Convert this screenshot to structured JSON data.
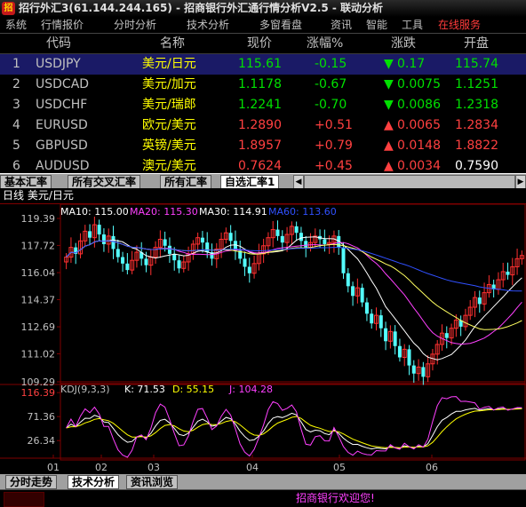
{
  "window": {
    "title": "招行外汇3(61.144.244.165) - 招商银行外汇通行情分析V2.5 - 联动分析",
    "logo_char": "招"
  },
  "menu": {
    "items": [
      {
        "label": "系统",
        "hot": false
      },
      {
        "label": "行情报价",
        "hot": false
      },
      {
        "label": "分时分析",
        "hot": false
      },
      {
        "label": "技术分析",
        "hot": false
      },
      {
        "label": "多窗看盘",
        "hot": false
      },
      {
        "label": "资讯",
        "hot": false
      },
      {
        "label": "智能",
        "hot": false
      },
      {
        "label": "工具",
        "hot": false
      },
      {
        "label": "在线服务",
        "hot": true
      }
    ]
  },
  "quotes": {
    "headers": {
      "code": "代码",
      "name": "名称",
      "price": "现价",
      "pct": "涨幅%",
      "change": "涨跌",
      "open": "开盘"
    },
    "rows": [
      {
        "num": "1",
        "code": "USDJPY",
        "name": "美元/日元",
        "price": "115.61",
        "pct": "-0.15",
        "change": "0.17",
        "dir": "down",
        "open": "115.74",
        "open_dir": "down"
      },
      {
        "num": "2",
        "code": "USDCAD",
        "name": "美元/加元",
        "price": "1.1178",
        "pct": "-0.67",
        "change": "0.0075",
        "dir": "down",
        "open": "1.1251",
        "open_dir": "down"
      },
      {
        "num": "3",
        "code": "USDCHF",
        "name": "美元/瑞郎",
        "price": "1.2241",
        "pct": "-0.70",
        "change": "0.0086",
        "dir": "down",
        "open": "1.2318",
        "open_dir": "down"
      },
      {
        "num": "4",
        "code": "EURUSD",
        "name": "欧元/美元",
        "price": "1.2890",
        "pct": "+0.51",
        "change": "0.0065",
        "dir": "up",
        "open": "1.2834",
        "open_dir": "up"
      },
      {
        "num": "5",
        "code": "GBPUSD",
        "name": "英镑/美元",
        "price": "1.8957",
        "pct": "+0.79",
        "change": "0.0148",
        "dir": "up",
        "open": "1.8822",
        "open_dir": "up"
      },
      {
        "num": "6",
        "code": "AUDUSD",
        "name": "澳元/美元",
        "price": "0.7624",
        "pct": "+0.45",
        "change": "0.0034",
        "dir": "up",
        "open": "0.7590",
        "open_dir": "flat"
      }
    ]
  },
  "rate_tabs": [
    "基本汇率",
    "所有交叉汇率",
    "所有汇率",
    "自选汇率1"
  ],
  "chart": {
    "header": "日线 美元/日元",
    "ma_labels": [
      {
        "text": "MA10: 115.00",
        "color": "#ffffff"
      },
      {
        "text": "MA20: 115.30",
        "color": "#ff40ff"
      },
      {
        "text": "MA30: 114.91",
        "color": "#ffffff"
      },
      {
        "text": "MA60: 113.60",
        "color": "#3050ff"
      }
    ],
    "kdj_labels": [
      {
        "text": "KDJ(9,3,3)",
        "color": "#c0c0c0"
      },
      {
        "text": "K: 71.53",
        "color": "#ffffff"
      },
      {
        "text": "D: 55.15",
        "color": "#ffff00"
      },
      {
        "text": "J: 104.28",
        "color": "#ff40ff"
      }
    ],
    "price_ticks": [
      "119.39",
      "117.72",
      "116.04",
      "114.37",
      "112.69",
      "111.02",
      "109.29"
    ],
    "kdj_ticks": [
      "116.39",
      "71.36",
      "26.34"
    ],
    "month_ticks": [
      "01",
      "02",
      "03",
      "04",
      "05",
      "06"
    ]
  },
  "chart_data": {
    "type": "candlestick",
    "title": "日线 美元/日元",
    "ylim": [
      109.29,
      119.39
    ],
    "x": [
      "01",
      "02",
      "03",
      "04",
      "05",
      "06"
    ],
    "closes": [
      117.0,
      117.6,
      117.2,
      118.0,
      118.6,
      118.2,
      119.0,
      118.4,
      117.8,
      118.3,
      117.5,
      117.0,
      116.6,
      116.2,
      116.8,
      117.3,
      116.9,
      116.5,
      117.0,
      117.6,
      118.1,
      117.7,
      117.2,
      116.8,
      116.3,
      116.7,
      117.2,
      117.8,
      118.2,
      117.9,
      117.3,
      116.9,
      117.5,
      118.1,
      118.5,
      118.0,
      117.4,
      116.9,
      116.4,
      116.0,
      116.6,
      117.2,
      117.7,
      118.2,
      118.7,
      118.3,
      117.9,
      118.4,
      118.9,
      118.5,
      118.0,
      117.6,
      117.9,
      118.3,
      118.1,
      117.8,
      117.9,
      118.3,
      117.6,
      116.0,
      115.2,
      114.6,
      115.1,
      114.2,
      113.5,
      112.9,
      113.4,
      112.6,
      111.8,
      112.4,
      111.5,
      110.8,
      111.3,
      110.3,
      109.8,
      110.2,
      109.6,
      110.4,
      111.0,
      111.6,
      112.3,
      112.0,
      112.6,
      113.1,
      112.7,
      113.4,
      113.9,
      114.5,
      114.1,
      114.8,
      115.3,
      115.0,
      115.6,
      116.1,
      115.9,
      116.4,
      116.9,
      117.1
    ],
    "kdj_ylim": [
      0,
      130
    ]
  },
  "bottom_tabs": [
    "分时走势",
    "技术分析",
    "资讯浏览"
  ],
  "status": {
    "text": "招商银行欢迎您!"
  }
}
